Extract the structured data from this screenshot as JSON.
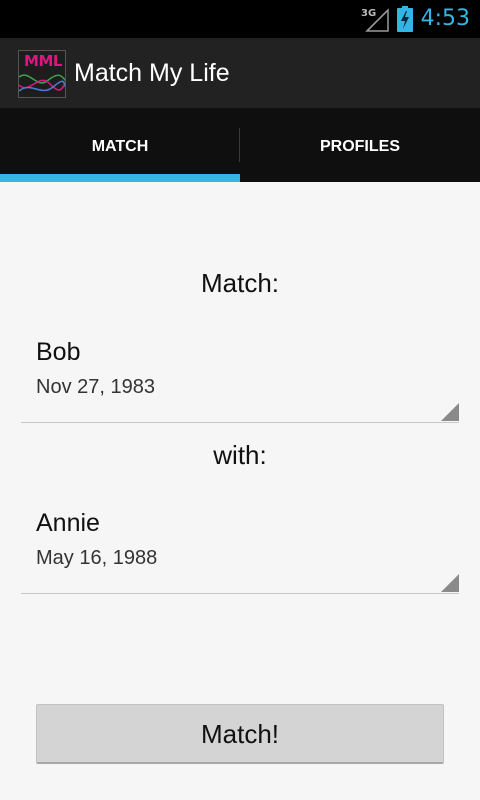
{
  "status_bar": {
    "network_type": "3G",
    "time": "4:53",
    "icons": [
      "signal-icon",
      "battery-charging-icon"
    ],
    "clock_color": "#33b5e5"
  },
  "action_bar": {
    "logo_text": "MML",
    "logo_color": "#e0157f",
    "title": "Match My Life"
  },
  "tabs": [
    {
      "label": "MATCH",
      "selected": true
    },
    {
      "label": "PROFILES",
      "selected": false
    }
  ],
  "tab_indicator_color": "#33b5e5",
  "main": {
    "match_label": "Match:",
    "with_label": "with:",
    "person_1": {
      "name": "Bob",
      "date": "Nov 27, 1983"
    },
    "person_2": {
      "name": "Annie",
      "date": "May 16, 1988"
    },
    "match_button_label": "Match!"
  }
}
